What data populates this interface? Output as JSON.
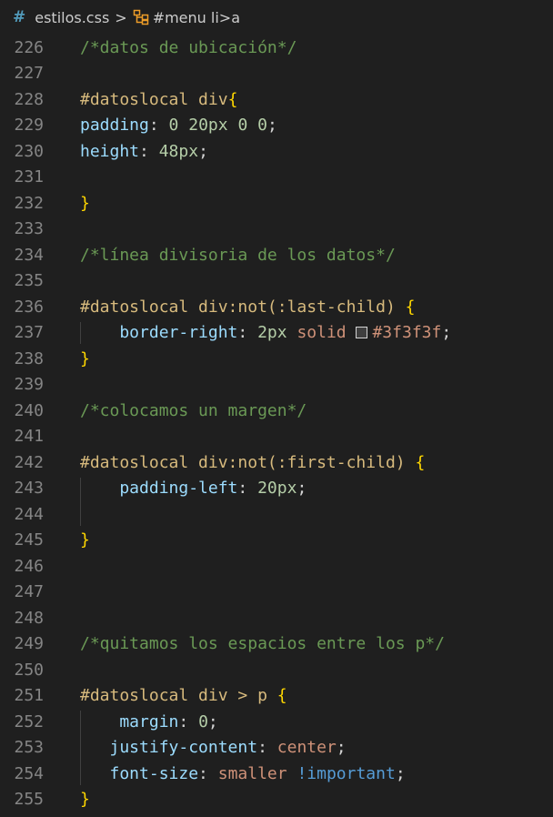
{
  "breadcrumb": {
    "file_icon": "css-hash-icon",
    "file": "estilos.css",
    "separator": ">",
    "symbol_icon": "symbol-class-icon",
    "symbol": "#menu li>a"
  },
  "lines": [
    {
      "n": "226",
      "tokens": [
        {
          "t": "/*datos de ubicación*/",
          "c": "comment"
        }
      ]
    },
    {
      "n": "227",
      "tokens": []
    },
    {
      "n": "228",
      "tokens": [
        {
          "t": "#datoslocal div",
          "c": "sel"
        },
        {
          "t": "{",
          "c": "brace"
        }
      ]
    },
    {
      "n": "229",
      "tokens": [
        {
          "t": "padding",
          "c": "prop"
        },
        {
          "t": ": ",
          "c": "punct"
        },
        {
          "t": "0",
          "c": "num"
        },
        {
          "t": " ",
          "c": "punct"
        },
        {
          "t": "20px",
          "c": "num"
        },
        {
          "t": " ",
          "c": "punct"
        },
        {
          "t": "0",
          "c": "num"
        },
        {
          "t": " ",
          "c": "punct"
        },
        {
          "t": "0",
          "c": "num"
        },
        {
          "t": ";",
          "c": "punct"
        }
      ]
    },
    {
      "n": "230",
      "tokens": [
        {
          "t": "height",
          "c": "prop"
        },
        {
          "t": ": ",
          "c": "punct"
        },
        {
          "t": "48px",
          "c": "num"
        },
        {
          "t": ";",
          "c": "punct"
        }
      ]
    },
    {
      "n": "231",
      "tokens": []
    },
    {
      "n": "232",
      "tokens": [
        {
          "t": "}",
          "c": "brace"
        }
      ]
    },
    {
      "n": "233",
      "tokens": []
    },
    {
      "n": "234",
      "tokens": [
        {
          "t": "/*línea divisoria de los datos*/",
          "c": "comment"
        }
      ]
    },
    {
      "n": "235",
      "tokens": []
    },
    {
      "n": "236",
      "tokens": [
        {
          "t": "#datoslocal div:not(:last-child)",
          "c": "sel"
        },
        {
          "t": " ",
          "c": "punct"
        },
        {
          "t": "{",
          "c": "brace"
        }
      ]
    },
    {
      "n": "237",
      "tokens": [
        {
          "t": "    border-right",
          "c": "prop"
        },
        {
          "t": ": ",
          "c": "punct"
        },
        {
          "t": "2px",
          "c": "num"
        },
        {
          "t": " ",
          "c": "punct"
        },
        {
          "t": "solid",
          "c": "val"
        },
        {
          "t": " ",
          "c": "punct"
        },
        {
          "swatch": true
        },
        {
          "t": "#3f3f3f",
          "c": "val"
        },
        {
          "t": ";",
          "c": "punct"
        }
      ]
    },
    {
      "n": "238",
      "tokens": [
        {
          "t": "}",
          "c": "brace"
        }
      ]
    },
    {
      "n": "239",
      "tokens": []
    },
    {
      "n": "240",
      "tokens": [
        {
          "t": "/*colocamos un margen*/",
          "c": "comment"
        }
      ]
    },
    {
      "n": "241",
      "tokens": []
    },
    {
      "n": "242",
      "tokens": [
        {
          "t": "#datoslocal div:not(:first-child)",
          "c": "sel"
        },
        {
          "t": " ",
          "c": "punct"
        },
        {
          "t": "{",
          "c": "brace"
        }
      ]
    },
    {
      "n": "243",
      "tokens": [
        {
          "t": "    padding-left",
          "c": "prop"
        },
        {
          "t": ": ",
          "c": "punct"
        },
        {
          "t": "20px",
          "c": "num"
        },
        {
          "t": ";",
          "c": "punct"
        }
      ]
    },
    {
      "n": "244",
      "tokens": []
    },
    {
      "n": "245",
      "tokens": [
        {
          "t": "}",
          "c": "brace"
        }
      ]
    },
    {
      "n": "246",
      "tokens": []
    },
    {
      "n": "247",
      "tokens": []
    },
    {
      "n": "248",
      "tokens": []
    },
    {
      "n": "249",
      "tokens": [
        {
          "t": "/*quitamos los espacios entre los p*/",
          "c": "comment"
        }
      ]
    },
    {
      "n": "250",
      "tokens": []
    },
    {
      "n": "251",
      "tokens": [
        {
          "t": "#datoslocal div > p",
          "c": "sel"
        },
        {
          "t": " ",
          "c": "punct"
        },
        {
          "t": "{",
          "c": "brace"
        }
      ]
    },
    {
      "n": "252",
      "tokens": [
        {
          "t": "    margin",
          "c": "prop"
        },
        {
          "t": ": ",
          "c": "punct"
        },
        {
          "t": "0",
          "c": "num"
        },
        {
          "t": ";",
          "c": "punct"
        }
      ]
    },
    {
      "n": "253",
      "tokens": [
        {
          "t": "   justify-content",
          "c": "prop"
        },
        {
          "t": ": ",
          "c": "punct"
        },
        {
          "t": "center",
          "c": "val"
        },
        {
          "t": ";",
          "c": "punct"
        }
      ]
    },
    {
      "n": "254",
      "tokens": [
        {
          "t": "   font-size",
          "c": "prop"
        },
        {
          "t": ": ",
          "c": "punct"
        },
        {
          "t": "smaller",
          "c": "val"
        },
        {
          "t": " ",
          "c": "punct"
        },
        {
          "t": "!important",
          "c": "imp"
        },
        {
          "t": ";",
          "c": "punct"
        }
      ]
    },
    {
      "n": "255",
      "tokens": [
        {
          "t": "}",
          "c": "brace"
        }
      ]
    }
  ]
}
